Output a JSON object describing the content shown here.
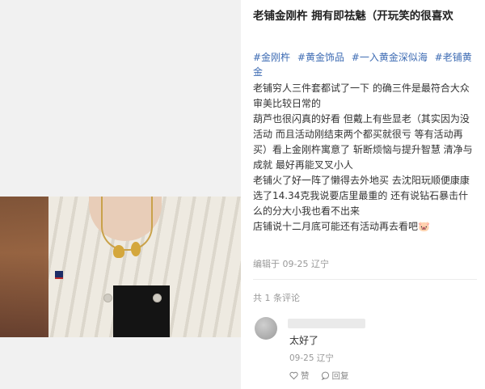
{
  "post": {
    "title": "老铺金刚杵 拥有即祛魅（开玩笑的很喜欢",
    "tags": [
      "#金刚杵",
      "#黄金饰品",
      "#一入黄金深似海",
      "#老铺黄金"
    ],
    "body": [
      "老铺穷人三件套都试了一下 的确三件是最符合大众审美比较日常的",
      "葫芦也很闪真的好看 但戴上有些显老（其实因为没活动 而且活动刚结束两个都买就很亏 等有活动再买）看上金刚杵寓意了 斩断烦恼与提升智慧 清净与成就 最好再能叉叉小人",
      "老铺火了好一阵了懒得去外地买 去沈阳玩顺便康康 选了14.34克我说要店里最重的 还有说钻石暴击什么的分大小我也看不出来",
      "店铺说十二月底可能还有活动再去看吧🐷"
    ],
    "meta": "编辑于 09-25 辽宁"
  },
  "comments": {
    "count_label": "共 1 条评论",
    "items": [
      {
        "text": "太好了",
        "meta": "09-25 辽宁",
        "like_label": "赞",
        "reply_label": "回复"
      }
    ]
  },
  "icons": {
    "like": "heart-icon",
    "reply": "reply-bubble-icon"
  },
  "colors": {
    "tag": "#3d6bb3",
    "meta": "#999999"
  }
}
